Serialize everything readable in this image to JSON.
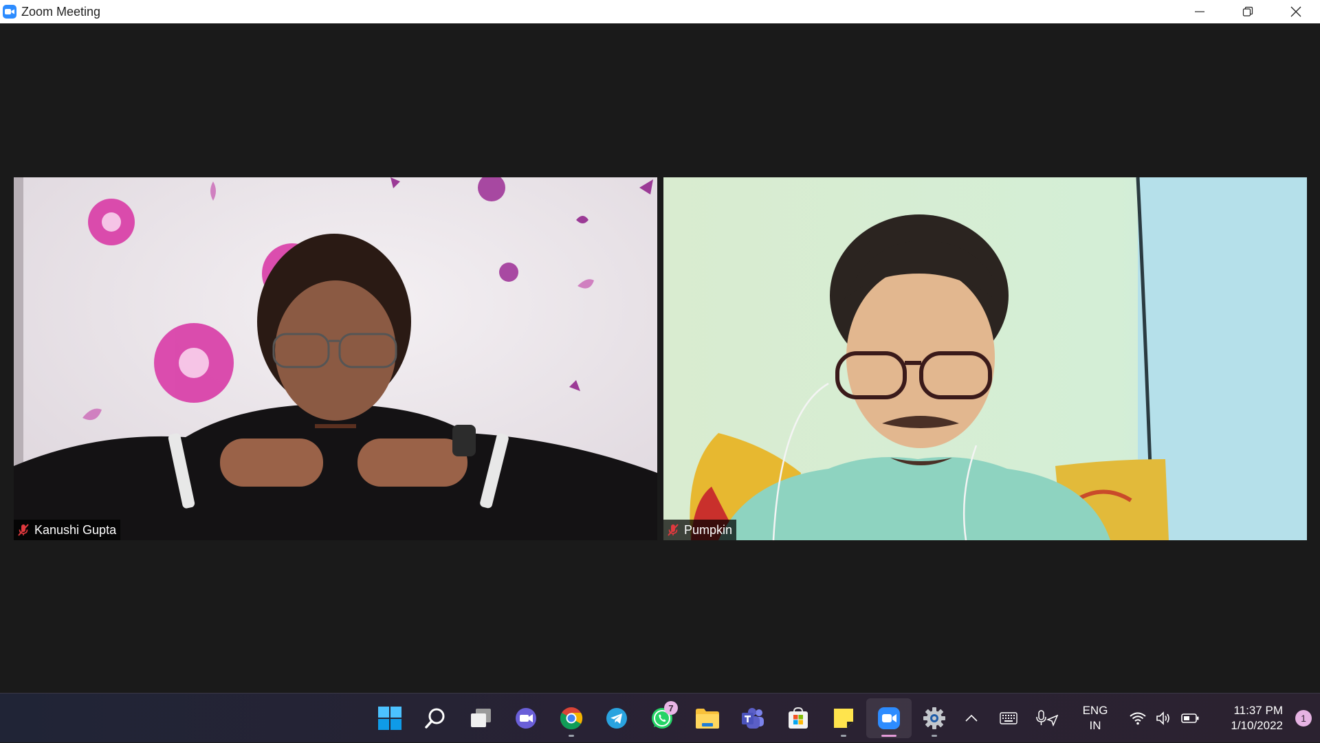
{
  "window": {
    "title": "Zoom Meeting",
    "controls": [
      "minimize-icon",
      "restore-icon",
      "close-icon"
    ]
  },
  "participants": [
    {
      "name": "Kanushi Gupta",
      "muted": true,
      "muted_icon": "microphone-muted-icon"
    },
    {
      "name": "Pumpkin",
      "muted": true,
      "muted_icon": "microphone-muted-icon"
    }
  ],
  "taskbar": {
    "apps": [
      {
        "name": "start",
        "icon": "windows-start-icon"
      },
      {
        "name": "search",
        "icon": "search-icon"
      },
      {
        "name": "task-view",
        "icon": "task-view-icon"
      },
      {
        "name": "chat",
        "icon": "teams-chat-icon"
      },
      {
        "name": "chrome",
        "icon": "chrome-icon",
        "running": true
      },
      {
        "name": "telegram",
        "icon": "telegram-icon"
      },
      {
        "name": "whatsapp",
        "icon": "whatsapp-icon",
        "badge": "7"
      },
      {
        "name": "file-explorer",
        "icon": "folder-icon"
      },
      {
        "name": "teams",
        "icon": "teams-icon"
      },
      {
        "name": "store",
        "icon": "store-icon"
      },
      {
        "name": "sticky-notes",
        "icon": "sticky-notes-icon",
        "running": true
      },
      {
        "name": "zoom",
        "icon": "zoom-icon",
        "running": true,
        "active": true
      },
      {
        "name": "settings",
        "icon": "settings-icon",
        "running": true
      }
    ],
    "tray": {
      "lang_line1": "ENG",
      "lang_line2": "IN",
      "time": "11:37 PM",
      "date": "1/10/2022",
      "notification_count": "1"
    }
  },
  "colors": {
    "meeting_bg": "#1a1a1a",
    "zoom_blue": "#2D8CFF",
    "muted_red": "#e0393e",
    "active_indicator": "#e49bd8"
  }
}
